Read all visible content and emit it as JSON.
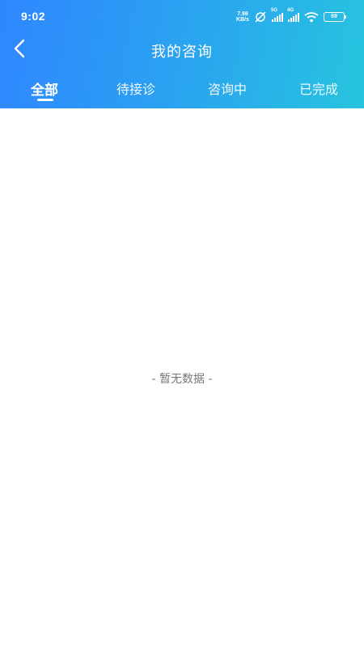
{
  "status_bar": {
    "time": "9:02",
    "net_speed_value": "7.98",
    "net_speed_unit": "KB/s",
    "signal1_label": "5G",
    "signal2_label": "4G",
    "battery": "69"
  },
  "nav": {
    "title": "我的咨询"
  },
  "tabs": [
    {
      "label": "全部"
    },
    {
      "label": "待接诊"
    },
    {
      "label": "咨询中"
    },
    {
      "label": "已完成"
    }
  ],
  "empty_state": {
    "text": "- 暂无数据 -"
  },
  "colors": {
    "header_gradient_start": "#2f86ff",
    "header_gradient_end": "#27c4de",
    "empty_text": "#777777"
  }
}
